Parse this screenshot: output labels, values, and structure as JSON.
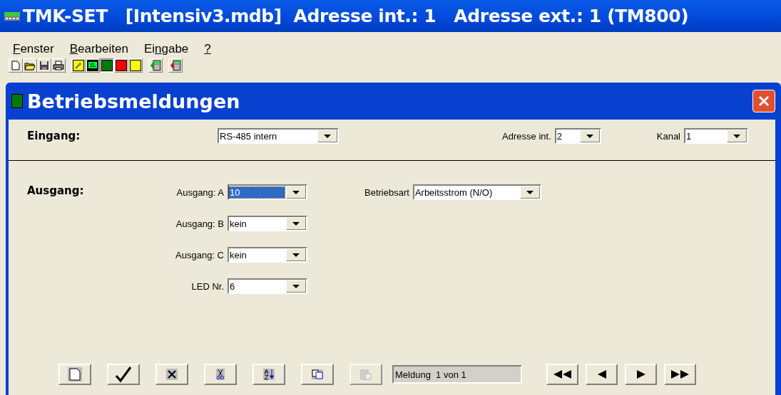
{
  "window": {
    "title": "TMK-SET   [Intensiv3.mdb]  Adresse int.: 1   Adresse ext.: 1 (TM800)"
  },
  "menu": [
    {
      "underlined": "F",
      "after": "enster"
    },
    {
      "underlined": "B",
      "after": "earbeiten"
    },
    {
      "before": "Ei",
      "underlined": "n",
      "after": "gabe"
    },
    {
      "underlined": "?"
    }
  ],
  "toolbar": [
    {
      "kind": "new",
      "selected": false
    },
    {
      "kind": "open",
      "selected": false
    },
    {
      "kind": "save",
      "selected": false
    },
    {
      "kind": "print",
      "selected": false
    },
    {
      "kind": "wrench",
      "selected": false
    },
    {
      "kind": "monitor",
      "selected": false
    },
    {
      "kind": "square",
      "color": "#007a00",
      "selected": true
    },
    {
      "kind": "square",
      "color": "#ff0000",
      "selected": false
    },
    {
      "kind": "square",
      "color": "#ffff00",
      "selected": false
    },
    {
      "kind": "device",
      "color": "#00a000",
      "selected": false
    },
    {
      "kind": "device",
      "color": "#d00000",
      "selected": false
    }
  ],
  "dialog": {
    "title": "Betriebsmeldungen",
    "input": {
      "heading": "Eingang:",
      "source": {
        "value": "RS-485 intern"
      },
      "address": {
        "label": "Adresse int.",
        "value": "2"
      },
      "channel": {
        "label": "Kanal",
        "value": "1"
      }
    },
    "output": {
      "heading": "Ausgang:",
      "rows": [
        {
          "label": "Ausgang: A",
          "value": "10",
          "focused": true
        },
        {
          "label": "Ausgang: B",
          "value": "kein",
          "focused": false
        },
        {
          "label": "Ausgang: C",
          "value": "kein",
          "focused": false
        },
        {
          "label": "LED Nr.",
          "value": "6",
          "focused": false
        }
      ],
      "mode": {
        "label": "Betriebsart",
        "value": "Arbeitsstrom (N/O)"
      }
    },
    "actions": [
      {
        "kind": "new",
        "disabled": false
      },
      {
        "kind": "check",
        "disabled": false
      },
      {
        "kind": "delete",
        "disabled": false
      },
      {
        "kind": "cut",
        "disabled": false
      },
      {
        "kind": "sort",
        "disabled": false
      },
      {
        "kind": "copy",
        "disabled": false
      },
      {
        "kind": "paste",
        "disabled": true
      }
    ],
    "record": "Meldung  1 von 1",
    "navigation": [
      {
        "kind": "first"
      },
      {
        "kind": "previous"
      },
      {
        "kind": "next"
      },
      {
        "kind": "last"
      }
    ]
  }
}
